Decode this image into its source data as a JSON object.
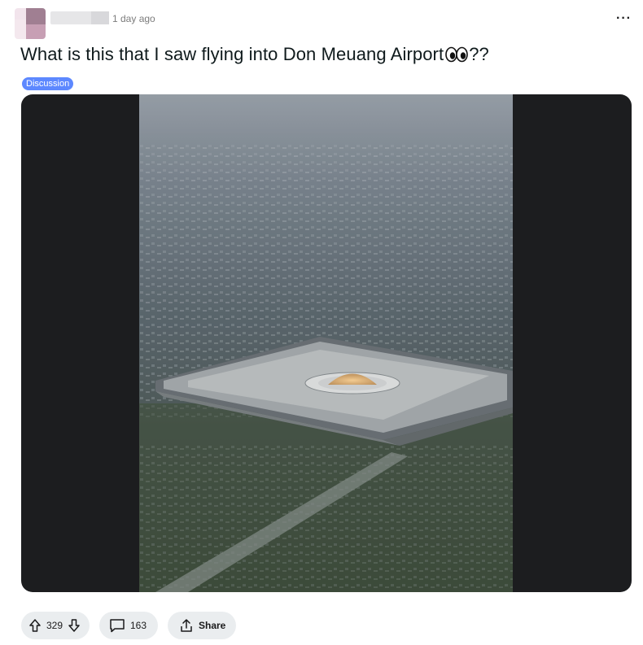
{
  "post": {
    "timestamp": "1 day ago",
    "title": "What is this that I saw flying into Don Meuang Airport",
    "title_suffix": "??",
    "title_emoji": "eyes-emoji",
    "flair": "Discussion",
    "flair_color": "#5d88ff",
    "more_icon": "ellipsis-icon"
  },
  "media": {
    "type": "image",
    "description_icon": "aerial-photo"
  },
  "actions": {
    "upvote_icon": "arrow-up-icon",
    "score": "329",
    "downvote_icon": "arrow-down-icon",
    "comment_icon": "comment-bubble-icon",
    "comments": "163",
    "share_icon": "share-icon",
    "share_label": "Share"
  },
  "colors": {
    "pill_bg": "#eaedef",
    "media_bg": "#1c1d1f"
  }
}
